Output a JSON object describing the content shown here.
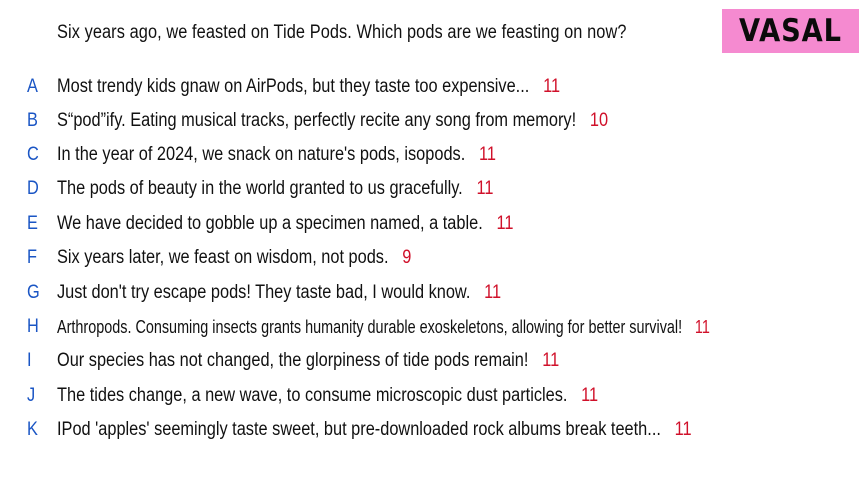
{
  "prompt": "Six years ago, we feasted on Tide Pods. Which pods are we feasting on now?",
  "player_name": "VASAL",
  "colors": {
    "letter": "#1a55c4",
    "vote_count": "#d0102a",
    "badge": "#f58ad0"
  },
  "answers": [
    {
      "letter": "A",
      "text": "Most trendy kids gnaw on AirPods, but they taste too expensive...",
      "votes": "11"
    },
    {
      "letter": "B",
      "text": "S“pod”ify. Eating musical tracks, perfectly recite any song from memory!",
      "votes": "10"
    },
    {
      "letter": "C",
      "text": "In the year of 2024, we snack on nature's pods, isopods.",
      "votes": "11"
    },
    {
      "letter": "D",
      "text": "The pods of beauty in the world granted to us gracefully.",
      "votes": "11"
    },
    {
      "letter": "E",
      "text": "We have decided to gobble up a specimen named, a table.",
      "votes": "11"
    },
    {
      "letter": "F",
      "text": "Six years later, we feast on wisdom, not pods.",
      "votes": "9"
    },
    {
      "letter": "G",
      "text": "Just don't try escape pods! They taste bad, I would know.",
      "votes": "11"
    },
    {
      "letter": "H",
      "text": "Arthropods. Consuming insects grants humanity durable exoskeletons, allowing for better survival!",
      "votes": "11"
    },
    {
      "letter": "I",
      "text": "Our species has not changed, the glorpiness of tide pods remain!",
      "votes": "11"
    },
    {
      "letter": "J",
      "text": "The tides change, a new wave, to consume microscopic dust particles.",
      "votes": "11"
    },
    {
      "letter": "K",
      "text": "IPod 'apples' seemingly taste sweet, but pre-downloaded rock albums break teeth...",
      "votes": "11"
    }
  ]
}
